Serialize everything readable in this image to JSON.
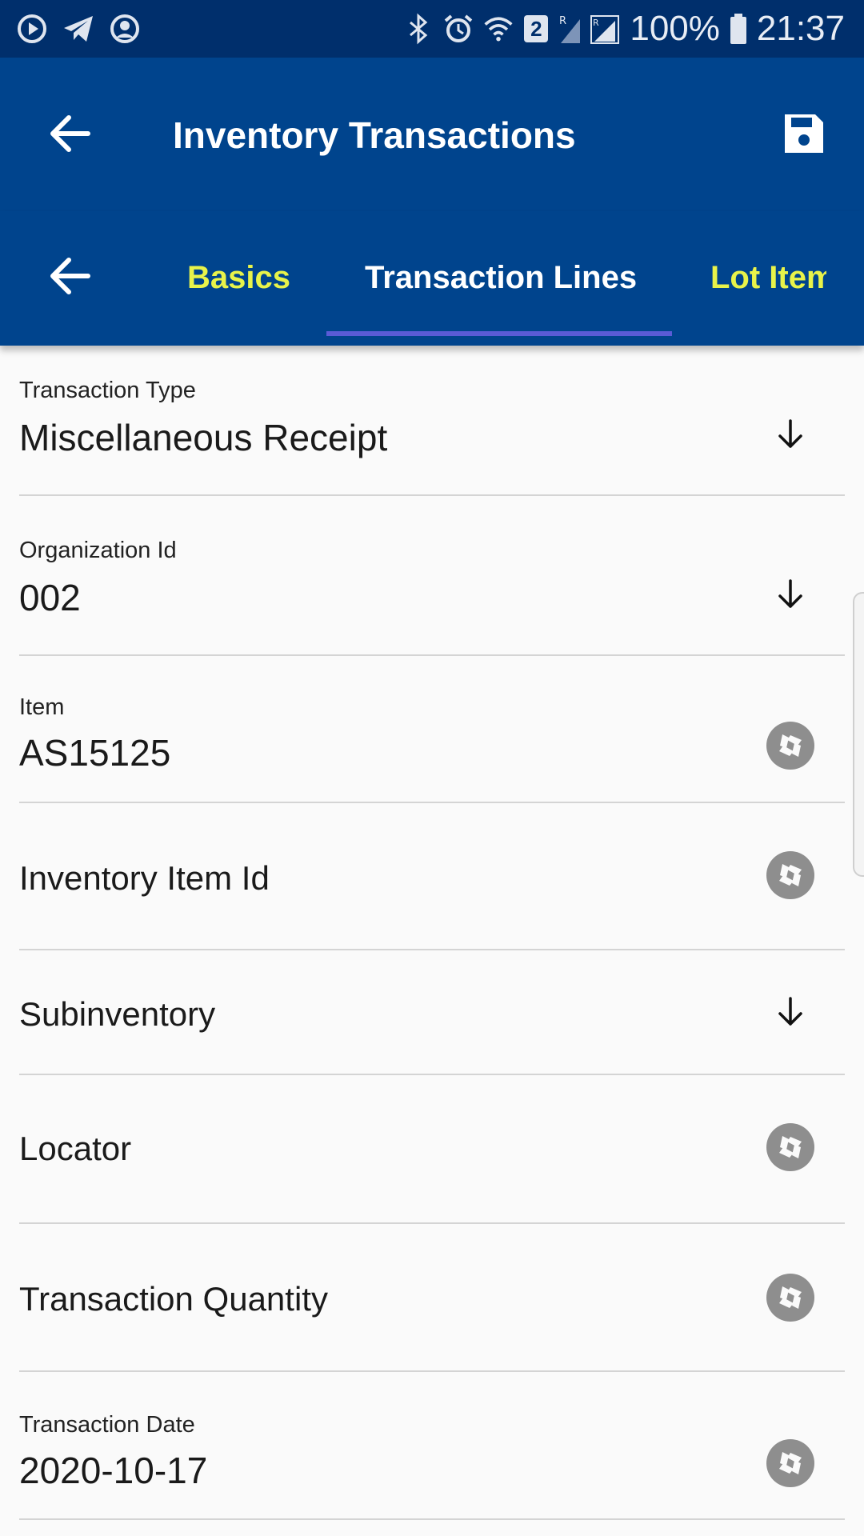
{
  "status_bar": {
    "battery": "100%",
    "time": "21:37",
    "sim_badge": "2",
    "icons": [
      "media-play-icon",
      "telegram-icon",
      "account-circle-icon",
      "bluetooth-icon",
      "alarm-icon",
      "wifi-icon",
      "signal-icon",
      "battery-icon"
    ]
  },
  "app_bar": {
    "title": "Inventory Transactions",
    "back_icon": "arrow-back-icon",
    "save_icon": "save-icon"
  },
  "tabs": {
    "items": [
      {
        "label": "Basics",
        "active": false
      },
      {
        "label": "Transaction Lines",
        "active": true
      },
      {
        "label": "Lot Item",
        "active": false
      }
    ],
    "accent_color": "#e8f34a",
    "indicator_color": "#5a5bd6"
  },
  "form": {
    "fields": [
      {
        "label": "Transaction Type",
        "value": "Miscellaneous Receipt",
        "icon": "arrow-down-icon"
      },
      {
        "label": "Organization Id",
        "value": "002",
        "icon": "arrow-down-icon"
      },
      {
        "label": "Item",
        "value": "AS15125",
        "icon": "camera-shutter-icon"
      },
      {
        "label": "Inventory Item Id",
        "value": "",
        "icon": "camera-shutter-icon"
      },
      {
        "label": "Subinventory",
        "value": "",
        "icon": "arrow-down-icon"
      },
      {
        "label": "Locator",
        "value": "",
        "icon": "camera-shutter-icon"
      },
      {
        "label": "Transaction Quantity",
        "value": "",
        "icon": "camera-shutter-icon"
      },
      {
        "label": "Transaction Date",
        "value": "2020-10-17",
        "icon": "camera-shutter-icon"
      }
    ]
  },
  "colors": {
    "status_bar": "#002f6c",
    "app_bar": "#00448d",
    "background": "#fafafa"
  }
}
